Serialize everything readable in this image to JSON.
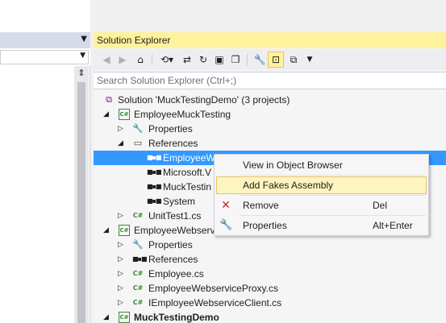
{
  "left_panel": {
    "title_dropdown_icon": "chevron-down-icon",
    "combo_dropdown_icon": "chevron-down-icon",
    "split_icon": "split-icon"
  },
  "solution_explorer": {
    "title": "Solution Explorer",
    "toolbar": {
      "buttons": [
        "back-icon",
        "forward-icon",
        "home-icon",
        "history-icon",
        "sync-icon",
        "refresh-icon",
        "collapse-all-icon",
        "show-all-files-icon",
        "properties-icon",
        "preview-icon",
        "view-switch-icon",
        "dropdown-icon"
      ]
    },
    "search": {
      "placeholder": "Search Solution Explorer (Ctrl+;)"
    },
    "tree": [
      {
        "label": "Solution 'MuckTestingDemo' (3 projects)",
        "icon": "solution-icon",
        "expander": ""
      },
      {
        "label": "EmployeeMuckTesting",
        "icon": "test-project-icon",
        "expander": "expanded"
      },
      {
        "label": "Properties",
        "icon": "wrench-icon",
        "expander": "collapsed"
      },
      {
        "label": "References",
        "icon": "references-icon",
        "expander": "expanded"
      },
      {
        "label": "EmployeeW",
        "icon": "reference-icon",
        "expander": "",
        "selected": true
      },
      {
        "label": "Microsoft.V",
        "icon": "reference-icon",
        "expander": ""
      },
      {
        "label": "MuckTestin",
        "icon": "reference-icon",
        "expander": ""
      },
      {
        "label": "System",
        "icon": "reference-icon",
        "expander": ""
      },
      {
        "label": "UnitTest1.cs",
        "icon": "csharp-file-icon",
        "expander": "collapsed"
      },
      {
        "label": "EmployeeWebservi",
        "icon": "csharp-project-icon",
        "expander": "expanded"
      },
      {
        "label": "Properties",
        "icon": "wrench-icon",
        "expander": "collapsed"
      },
      {
        "label": "References",
        "icon": "references-icon",
        "expander": "collapsed"
      },
      {
        "label": "Employee.cs",
        "icon": "csharp-file-icon",
        "expander": "collapsed"
      },
      {
        "label": "EmployeeWebserviceProxy.cs",
        "icon": "csharp-file-icon",
        "expander": "collapsed"
      },
      {
        "label": "IEmployeeWebserviceClient.cs",
        "icon": "csharp-file-icon",
        "expander": "collapsed"
      },
      {
        "label": "MuckTestingDemo",
        "icon": "csharp-project-icon",
        "expander": "expanded",
        "bold": true
      }
    ]
  },
  "context_menu": {
    "items": [
      {
        "label": "View in Object Browser",
        "shortcut": "",
        "icon": ""
      },
      {
        "label": "Add Fakes Assembly",
        "shortcut": "",
        "icon": "",
        "highlighted": true
      },
      {
        "label": "Remove",
        "shortcut": "Del",
        "icon": "remove-icon"
      },
      {
        "label": "Properties",
        "shortcut": "Alt+Enter",
        "icon": "wrench-icon"
      }
    ]
  },
  "colors": {
    "title_active": "#fff29d",
    "selection": "#3399ff",
    "menu_highlight": "#fdf4bf",
    "remove_red": "#c62828",
    "cs_green": "#388a34"
  }
}
